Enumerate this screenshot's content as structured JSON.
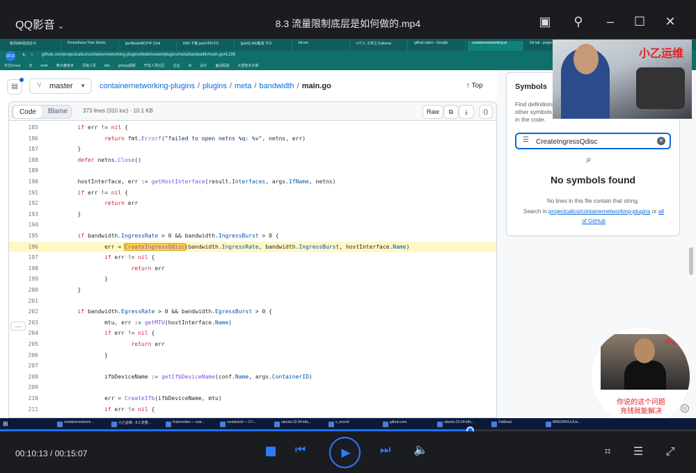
{
  "player": {
    "app_name": "QQ影音",
    "video_title": "8.3 流量限制底层是如何做的.mp4",
    "time_current": "00:10:13",
    "time_separator": " / ",
    "time_total": "00:15:07",
    "progress": 0.675,
    "accent": "#1e6fff"
  },
  "browser": {
    "tabs": [
      "斐讯MM信息办子",
      "Prometheus Time Series",
      "[perf]kubeMCP中 Cmd",
      "K8S-下载 part1中kTFS",
      "[part1] k8s集成 TFS",
      "bit.net",
      "cl个人 工作之 Kuberne",
      "github calico - Google",
      "containernetworking-pl",
      "Git lub - project"
    ],
    "address": "github.com/projectcalico/containernetworking-plugins/blob/master/plugins/meta/bandwidth/main.go#L196",
    "bookmarks": [
      "中文/Linux",
      "无",
      "work",
      "黄大酱技术",
      "贝锐人员",
      "k8s",
      "golang视频",
      "开发人员社区",
      "企业",
      "AI",
      "设计",
      "面试经验",
      "大雪技术文章"
    ]
  },
  "github": {
    "branch": "master",
    "breadcrumb": [
      "containernetworking-plugins",
      "plugins",
      "meta",
      "bandwidth"
    ],
    "file": "main.go",
    "top_label": "Top",
    "tab_code": "Code",
    "tab_blame": "Blame",
    "file_info": "373 lines (310 loc) · 10.1 KB",
    "raw_label": "Raw"
  },
  "symbols": {
    "title": "Symbols",
    "desc": "Find definitions and references for other symbols by name in this file or in the code.",
    "query": "CreateIngressQdisc",
    "no_results": "No symbols found",
    "sub": "No lines in this file contain that string.",
    "search_in": "Search in",
    "repo_link": "projectcalico/containernetworking-plugins",
    "or_text": "or",
    "all_link": "all of GitHub"
  },
  "code_lines": [
    {
      "n": "185",
      "t": "        if err != nil {"
    },
    {
      "n": "186",
      "t": "                return fmt.Errorf(\"failed to open netns %q: %v\", netns, err)"
    },
    {
      "n": "187",
      "t": "        }"
    },
    {
      "n": "188",
      "t": "        defer netns.Close()"
    },
    {
      "n": "189",
      "t": ""
    },
    {
      "n": "190",
      "t": "        hostInterface, err := getHostInterface(result.Interfaces, args.IfName, netns)"
    },
    {
      "n": "191",
      "t": "        if err != nil {"
    },
    {
      "n": "192",
      "t": "                return err"
    },
    {
      "n": "193",
      "t": "        }"
    },
    {
      "n": "194",
      "t": ""
    },
    {
      "n": "195",
      "t": "        if bandwidth.IngressRate > 0 && bandwidth.IngressBurst > 0 {"
    },
    {
      "n": "196",
      "t": "                err = CreateIngressQdisc(bandwidth.IngressRate, bandwidth.IngressBurst, hostInterface.Name)"
    },
    {
      "n": "197",
      "t": "                if err != nil {"
    },
    {
      "n": "198",
      "t": "                        return err"
    },
    {
      "n": "199",
      "t": "                }"
    },
    {
      "n": "200",
      "t": "        }"
    },
    {
      "n": "201",
      "t": ""
    },
    {
      "n": "202",
      "t": "        if bandwidth.EgressRate > 0 && bandwidth.EgressBurst > 0 {"
    },
    {
      "n": "203",
      "t": "                mtu, err := getMTU(hostInterface.Name)"
    },
    {
      "n": "204",
      "t": "                if err != nil {"
    },
    {
      "n": "205",
      "t": "                        return err"
    },
    {
      "n": "206",
      "t": "                }"
    },
    {
      "n": "207",
      "t": ""
    },
    {
      "n": "208",
      "t": "                ifbDeviceName := getIfbDeviceName(conf.Name, args.ContainerID)"
    },
    {
      "n": "209",
      "t": ""
    },
    {
      "n": "210",
      "t": "                err = CreateIfb(ifbDeviceName, mtu)"
    },
    {
      "n": "211",
      "t": "                if err != nil {"
    }
  ],
  "highlight_line": "196",
  "overlay": {
    "cam1_label": "小乙运维",
    "cam2_tag": "小乙",
    "cam2_text1": "你说的这个问题",
    "cam2_text2": "充钱就能解决"
  },
  "taskbar": [
    "containernetwork...",
    "小乙运维 - 8.3 流量...",
    "Kubernetes — kub...",
    "containerd — D:\\...",
    "ubuntu-22.04-k8s...",
    "v_record",
    "github.com",
    "ubuntu-22.04-k8s...",
    "Oddload",
    "MINGW64:/c/Us..."
  ],
  "icons": [
    "search-icon",
    "close-icon",
    "play-icon",
    "stop-icon",
    "prev-icon",
    "next-icon",
    "volume-icon",
    "settings-icon",
    "fullscreen-icon"
  ]
}
